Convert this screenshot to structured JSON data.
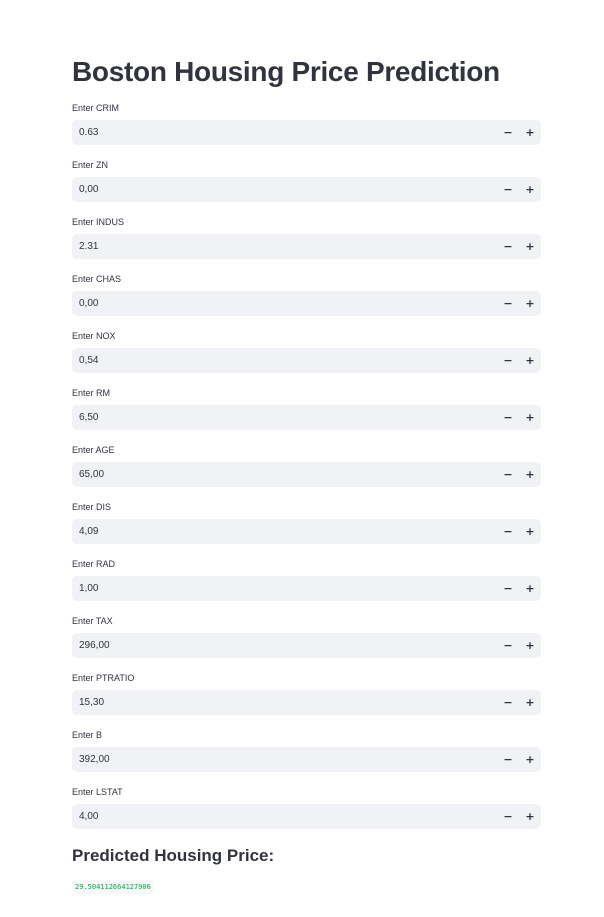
{
  "page": {
    "title": "Boston Housing Price Prediction"
  },
  "fields": [
    {
      "label": "Enter CRIM",
      "value": "0.63"
    },
    {
      "label": "Enter ZN",
      "value": "0,00"
    },
    {
      "label": "Enter INDUS",
      "value": "2.31"
    },
    {
      "label": "Enter CHAS",
      "value": "0,00"
    },
    {
      "label": "Enter NOX",
      "value": "0,54"
    },
    {
      "label": "Enter RM",
      "value": "6,50"
    },
    {
      "label": "Enter AGE",
      "value": "65,00"
    },
    {
      "label": "Enter DIS",
      "value": "4,09"
    },
    {
      "label": "Enter RAD",
      "value": "1,00"
    },
    {
      "label": "Enter TAX",
      "value": "296,00"
    },
    {
      "label": "Enter PTRATIO",
      "value": "15,30"
    },
    {
      "label": "Enter B",
      "value": "392,00"
    },
    {
      "label": "Enter LSTAT",
      "value": "4,00"
    }
  ],
  "stepper": {
    "minus_label": "−",
    "plus_label": "+"
  },
  "result": {
    "title": "Predicted Housing Price:",
    "value": "29.504112664127906"
  },
  "colors": {
    "background": "#ffffff",
    "input_background": "#f0f2f6",
    "text": "#31333f",
    "result_value": "#09ab3b"
  },
  "icons": {
    "minus": "minus-icon",
    "plus": "plus-icon"
  }
}
